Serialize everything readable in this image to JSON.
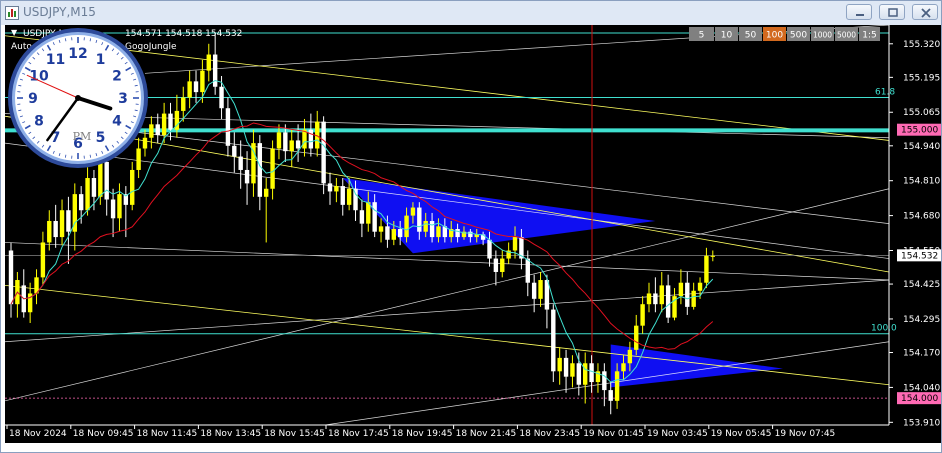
{
  "window": {
    "title": "USDJPY,M15"
  },
  "chart_header": {
    "symbol_line": "USDJPY,M15",
    "ohlc": "154.571 154.518 154.532",
    "expert": "Auto",
    "expert_suffix": "GogoJungle"
  },
  "timeframe_buttons": [
    {
      "label": "5",
      "active": false
    },
    {
      "label": "10",
      "active": false
    },
    {
      "label": "50",
      "active": false
    },
    {
      "label": "100",
      "active": true
    },
    {
      "label": "500",
      "active": false
    },
    {
      "label": "1000",
      "active": false
    },
    {
      "label": "5000",
      "active": false
    },
    {
      "label": "1:5",
      "active": false
    }
  ],
  "clock": {
    "numbers": [
      "12",
      "1",
      "2",
      "3",
      "4",
      "5",
      "6",
      "7",
      "8",
      "9",
      "10",
      "11"
    ],
    "period": "PM",
    "hour": 3.6,
    "minute": 36,
    "second": 49
  },
  "price_axis": {
    "labels": [
      "155.320",
      "155.195",
      "155.065",
      "154.940",
      "154.810",
      "154.680",
      "154.550",
      "154.425",
      "154.295",
      "154.170",
      "154.040",
      "153.910"
    ],
    "highlight_levels": [
      {
        "label": "155.000",
        "color": "#ff6ab4"
      },
      {
        "label": "154.532",
        "color": "#ffffff"
      },
      {
        "label": "154.000",
        "color": "#ff6ab4"
      }
    ]
  },
  "fib_labels": {
    "level_61_8": "61.8",
    "level_100": "100.0"
  },
  "time_axis": {
    "labels": [
      "18 Nov 2024",
      "18 Nov 09:45",
      "18 Nov 11:45",
      "18 Nov 13:45",
      "18 Nov 15:45",
      "18 Nov 17:45",
      "18 Nov 19:45",
      "18 Nov 21:45",
      "18 Nov 23:45",
      "19 Nov 01:45",
      "19 Nov 03:45",
      "19 Nov 05:45",
      "19 Nov 07:45"
    ]
  },
  "colors": {
    "background": "#000000",
    "candle_up": "#ffff00",
    "candle_down": "#ffffff",
    "fast_ma": "#40e0d0",
    "slow_ma": "#e01020",
    "trendline": "#ffffff",
    "channel": "#ffff60",
    "fib": "#40e0d0",
    "triangle": "#1010ff",
    "vline": "#d01010"
  },
  "chart_data": {
    "type": "candlestick",
    "ylim": [
      153.9,
      155.39
    ],
    "candles": [
      [
        154.55,
        154.35,
        154.58,
        154.3
      ],
      [
        154.35,
        154.44,
        154.47,
        154.3
      ],
      [
        154.42,
        154.32,
        154.48,
        154.3
      ],
      [
        154.32,
        154.39,
        154.43,
        154.28
      ],
      [
        154.39,
        154.45,
        154.48,
        154.35
      ],
      [
        154.45,
        154.58,
        154.62,
        154.42
      ],
      [
        154.58,
        154.66,
        154.7,
        154.55
      ],
      [
        154.66,
        154.6,
        154.72,
        154.56
      ],
      [
        154.6,
        154.7,
        154.74,
        154.57
      ],
      [
        154.7,
        154.62,
        154.75,
        154.5
      ],
      [
        154.62,
        154.76,
        154.8,
        154.55
      ],
      [
        154.76,
        154.7,
        154.79,
        154.65
      ],
      [
        154.7,
        154.82,
        154.86,
        154.68
      ],
      [
        154.82,
        154.75,
        154.85,
        154.7
      ],
      [
        154.75,
        154.88,
        154.92,
        154.72
      ],
      [
        154.88,
        154.74,
        154.9,
        154.68
      ],
      [
        154.74,
        154.67,
        154.78,
        154.6
      ],
      [
        154.67,
        154.76,
        154.8,
        154.62
      ],
      [
        154.76,
        154.72,
        154.79,
        154.6
      ],
      [
        154.72,
        154.85,
        154.88,
        154.7
      ],
      [
        154.85,
        154.93,
        154.97,
        154.82
      ],
      [
        154.93,
        154.97,
        155.0,
        154.9
      ],
      [
        154.97,
        155.02,
        155.05,
        154.93
      ],
      [
        155.02,
        154.98,
        155.06,
        154.95
      ],
      [
        154.98,
        155.06,
        155.1,
        154.95
      ],
      [
        155.06,
        155.0,
        155.1,
        154.96
      ],
      [
        155.0,
        155.07,
        155.13,
        154.97
      ],
      [
        155.07,
        155.12,
        155.16,
        155.03
      ],
      [
        155.12,
        155.18,
        155.22,
        155.08
      ],
      [
        155.18,
        155.14,
        155.22,
        155.1
      ],
      [
        155.14,
        155.22,
        155.26,
        155.1
      ],
      [
        155.22,
        155.28,
        155.32,
        155.18
      ],
      [
        155.28,
        155.16,
        155.36,
        155.13
      ],
      [
        155.16,
        155.08,
        155.2,
        155.04
      ],
      [
        155.08,
        154.94,
        155.12,
        154.9
      ],
      [
        154.94,
        154.9,
        154.99,
        154.84
      ],
      [
        154.9,
        154.85,
        154.96,
        154.78
      ],
      [
        154.85,
        154.8,
        154.92,
        154.72
      ],
      [
        154.8,
        154.95,
        155.0,
        154.75
      ],
      [
        154.95,
        154.75,
        154.98,
        154.7
      ],
      [
        154.75,
        154.78,
        154.82,
        154.58
      ],
      [
        154.78,
        154.93,
        154.96,
        154.74
      ],
      [
        154.93,
        154.99,
        155.02,
        154.89
      ],
      [
        154.99,
        154.92,
        155.02,
        154.88
      ],
      [
        154.92,
        154.96,
        155.0,
        154.86
      ],
      [
        154.96,
        154.93,
        155.02,
        154.88
      ],
      [
        154.93,
        155.0,
        155.04,
        154.9
      ],
      [
        155.0,
        154.93,
        155.06,
        154.9
      ],
      [
        154.93,
        155.03,
        155.07,
        154.9
      ],
      [
        155.03,
        154.8,
        155.05,
        154.76
      ],
      [
        154.8,
        154.77,
        154.84,
        154.72
      ],
      [
        154.77,
        154.79,
        154.82,
        154.73
      ],
      [
        154.79,
        154.72,
        154.82,
        154.68
      ],
      [
        154.72,
        154.78,
        154.82,
        154.7
      ],
      [
        154.78,
        154.7,
        154.81,
        154.66
      ],
      [
        154.7,
        154.65,
        154.74,
        154.6
      ],
      [
        154.65,
        154.73,
        154.77,
        154.62
      ],
      [
        154.73,
        154.62,
        154.76,
        154.6
      ],
      [
        154.62,
        154.64,
        154.67,
        154.58
      ],
      [
        154.64,
        154.59,
        154.68,
        154.56
      ],
      [
        154.59,
        154.63,
        154.66,
        154.57
      ],
      [
        154.63,
        154.6,
        154.66,
        154.57
      ],
      [
        154.6,
        154.68,
        154.71,
        154.58
      ],
      [
        154.68,
        154.71,
        154.73,
        154.65
      ],
      [
        154.71,
        154.62,
        154.73,
        154.59
      ],
      [
        154.62,
        154.66,
        154.69,
        154.6
      ],
      [
        154.66,
        154.6,
        154.69,
        154.58
      ],
      [
        154.6,
        154.64,
        154.67,
        154.58
      ],
      [
        154.64,
        154.6,
        154.67,
        154.58
      ],
      [
        154.6,
        154.63,
        154.66,
        154.58
      ],
      [
        154.63,
        154.6,
        154.65,
        154.58
      ],
      [
        154.6,
        154.62,
        154.64,
        154.59
      ],
      [
        154.62,
        154.6,
        154.63,
        154.58
      ],
      [
        154.6,
        154.61,
        154.63,
        154.58
      ],
      [
        154.61,
        154.59,
        154.62,
        154.57
      ],
      [
        154.59,
        154.52,
        154.62,
        154.49
      ],
      [
        154.52,
        154.47,
        154.55,
        154.42
      ],
      [
        154.47,
        154.52,
        154.55,
        154.45
      ],
      [
        154.52,
        154.55,
        154.58,
        154.5
      ],
      [
        154.55,
        154.6,
        154.64,
        154.52
      ],
      [
        154.6,
        154.52,
        154.63,
        154.48
      ],
      [
        154.52,
        154.43,
        154.55,
        154.38
      ],
      [
        154.43,
        154.37,
        154.46,
        154.32
      ],
      [
        154.37,
        154.44,
        154.47,
        154.34
      ],
      [
        154.44,
        154.33,
        154.46,
        154.26
      ],
      [
        154.33,
        154.1,
        154.35,
        154.06
      ],
      [
        154.1,
        154.15,
        154.19,
        154.05
      ],
      [
        154.15,
        154.08,
        154.18,
        154.02
      ],
      [
        154.08,
        154.13,
        154.16,
        154.04
      ],
      [
        154.13,
        154.05,
        154.17,
        154.01
      ],
      [
        154.05,
        154.13,
        154.17,
        153.98
      ],
      [
        154.13,
        154.06,
        154.16,
        154.02
      ],
      [
        154.06,
        154.1,
        154.13,
        154.02
      ],
      [
        154.1,
        154.03,
        154.13,
        153.97
      ],
      [
        154.03,
        153.99,
        154.06,
        153.94
      ],
      [
        153.99,
        154.1,
        154.13,
        153.96
      ],
      [
        154.1,
        154.13,
        154.16,
        154.07
      ],
      [
        154.13,
        154.18,
        154.21,
        154.1
      ],
      [
        154.18,
        154.27,
        154.31,
        154.16
      ],
      [
        154.27,
        154.35,
        154.38,
        154.24
      ],
      [
        154.35,
        154.39,
        154.43,
        154.32
      ],
      [
        154.39,
        154.35,
        154.45,
        154.32
      ],
      [
        154.35,
        154.42,
        154.47,
        154.32
      ],
      [
        154.42,
        154.3,
        154.46,
        154.28
      ],
      [
        154.3,
        154.38,
        154.41,
        154.29
      ],
      [
        154.38,
        154.43,
        154.48,
        154.35
      ],
      [
        154.43,
        154.34,
        154.47,
        154.31
      ],
      [
        154.34,
        154.4,
        154.43,
        154.33
      ],
      [
        154.4,
        154.43,
        154.45,
        154.37
      ],
      [
        154.43,
        154.53,
        154.56,
        154.41
      ],
      [
        154.53,
        154.53,
        154.55,
        154.51
      ]
    ]
  }
}
